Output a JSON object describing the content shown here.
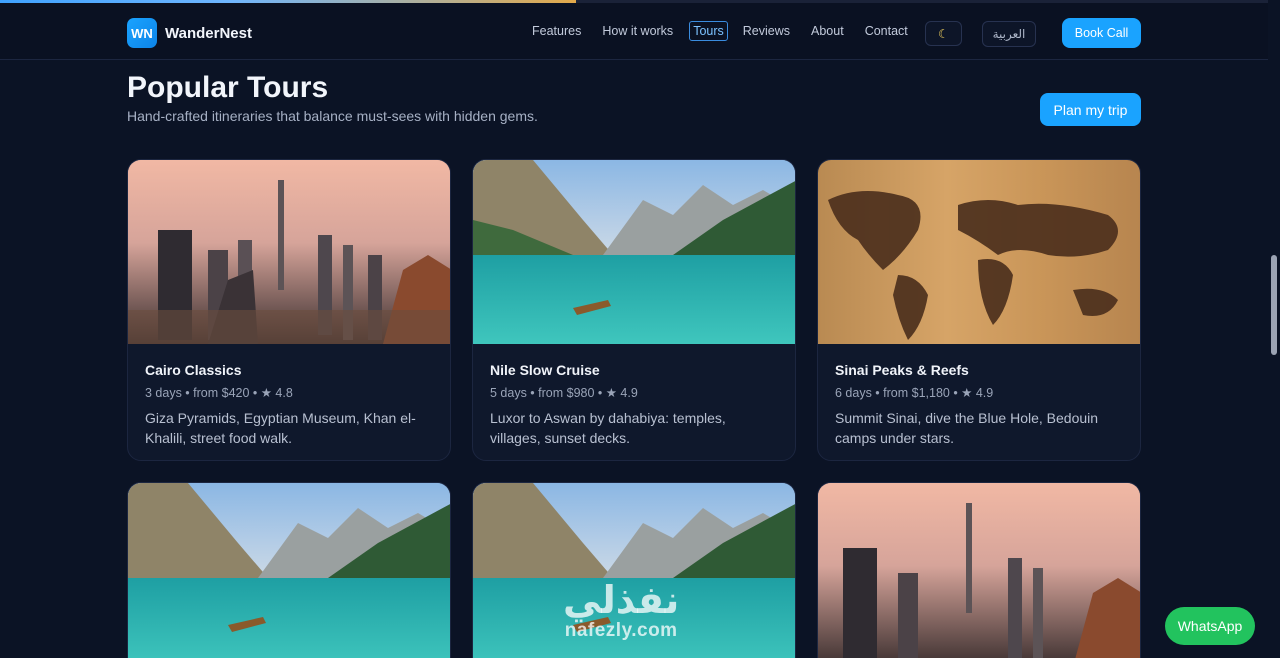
{
  "progress": 0.45,
  "brand": {
    "logo": "WN",
    "name": "WanderNest"
  },
  "nav": {
    "links": [
      "Features",
      "How it works",
      "Tours",
      "Reviews",
      "About",
      "Contact"
    ],
    "active": "Tours",
    "theme_icon": "moon-icon",
    "lang": "العربية",
    "cta": "Book Call"
  },
  "section": {
    "title": "Popular Tours",
    "subtitle": "Hand-crafted itineraries that balance must-sees with hidden gems.",
    "cta": "Plan my trip"
  },
  "tours": [
    {
      "title": "Cairo Classics",
      "meta": "3 days • from $420 • ★ 4.8",
      "desc": "Giza Pyramids, Egyptian Museum, Khan el-Khalili, street food walk."
    },
    {
      "title": "Nile Slow Cruise",
      "meta": "5 days • from $980 • ★ 4.9",
      "desc": "Luxor to Aswan by dahabiya: temples, villages, sunset decks."
    },
    {
      "title": "Sinai Peaks & Reefs",
      "meta": "6 days • from $1,180 • ★ 4.9",
      "desc": "Summit Sinai, dive the Blue Hole, Bedouin camps under stars."
    }
  ],
  "colors": {
    "accent": "#1aa3ff",
    "whatsapp": "#22c35e",
    "background": "#0b1325"
  },
  "whatsapp": "WhatsApp",
  "watermark": {
    "arabic": "نفذلي",
    "latin": "nafezly.com"
  }
}
